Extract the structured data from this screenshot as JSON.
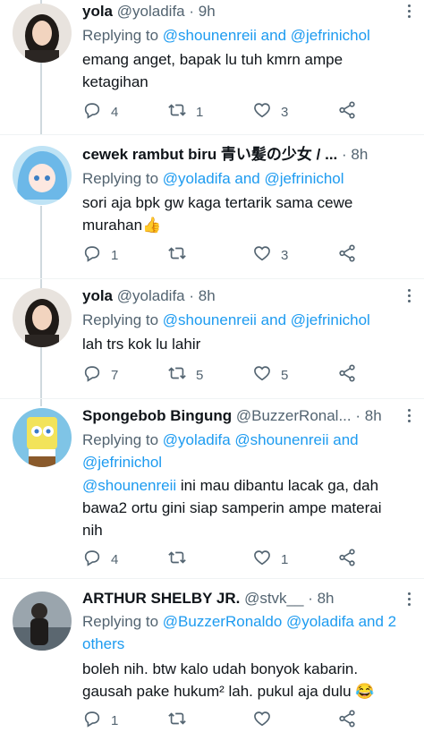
{
  "tweets": [
    {
      "name": "yola",
      "handle": "@yoladifa",
      "time": "9h",
      "replying_prefix": "Replying to",
      "replying_to": "@shounenreii and @jefrinichol",
      "text_lines": [
        "emang anget, bapak lu tuh kmrn ampe",
        "ketagihan"
      ],
      "replies": "4",
      "retweets": "1",
      "likes": "3"
    },
    {
      "name": "cewek rambut biru 青い髪の少女 / ...",
      "handle": "",
      "time": "8h",
      "replying_prefix": "Replying to",
      "replying_to": "@yoladifa and @jefrinichol",
      "text_lines": [
        "sori aja bpk gw kaga tertarik sama cewe",
        "murahan👍"
      ],
      "replies": "1",
      "retweets": "",
      "likes": "3"
    },
    {
      "name": "yola",
      "handle": "@yoladifa",
      "time": "8h",
      "replying_prefix": "Replying to",
      "replying_to": "@shounenreii and @jefrinichol",
      "text_lines": [
        "lah trs kok lu lahir"
      ],
      "replies": "7",
      "retweets": "5",
      "likes": "5"
    },
    {
      "name": "Spongebob Bingung",
      "handle": "@BuzzerRonal...",
      "time": "8h",
      "replying_prefix": "Replying to",
      "replying_to_lines": [
        "@yoladifa @shounenreii and",
        "@jefrinichol"
      ],
      "mention": "@shounenreii",
      "text_after_mention": " ini mau dibantu lacak ga, dah",
      "text_lines_rest": [
        "bawa2 ortu gini siap samperin ampe materai",
        "nih"
      ],
      "replies": "4",
      "retweets": "",
      "likes": "1"
    },
    {
      "name": "ARTHUR SHELBY JR.",
      "handle": "@stvk__",
      "time": "8h",
      "replying_prefix": "Replying to",
      "replying_to_line1": "@BuzzerRonaldo @yoladifa and 2",
      "replying_to_line2": "others",
      "text_lines": [
        "boleh nih. btw kalo udah bonyok kabarin.",
        "gausah pake hukum² lah. pukul aja dulu 😂"
      ],
      "replies": "1",
      "retweets": "",
      "likes": ""
    }
  ],
  "icons": {
    "reply": "reply-icon",
    "retweet": "retweet-icon",
    "like": "like-icon",
    "share": "share-icon",
    "more": "more-icon"
  },
  "colors": {
    "link": "#1d9bf0",
    "secondary_text": "#536471",
    "primary_text": "#0f1419",
    "thread_line": "#cfd9de"
  }
}
